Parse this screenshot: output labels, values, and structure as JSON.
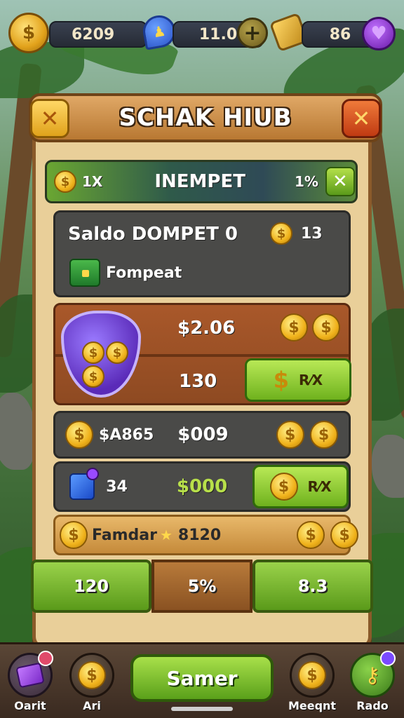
{
  "topbar": {
    "coins": "6209",
    "energy": "11.0",
    "gems": "86",
    "coin_icon_glyph": "$",
    "plus_glyph": "+"
  },
  "panel": {
    "title": "SCHAK HIUB",
    "close_glyph": "✕"
  },
  "wallet_bar": {
    "left_value": "1X",
    "label": "INEMPET",
    "right_value": "1%",
    "action_glyph": "✕"
  },
  "saldo": {
    "title": "Saldo DOMPET 0",
    "coin_value": "13",
    "item_label": "Fompeat"
  },
  "offer": {
    "price_top": "$2.06",
    "amount": "130",
    "buy_label": "R⁄X"
  },
  "rows": [
    {
      "left_label": "$A865",
      "value": "$009"
    },
    {
      "left_label": "34",
      "value": "$000",
      "buy_label": "R⁄X"
    },
    {
      "left_label": "Famdar",
      "star": "★",
      "value": "8120"
    }
  ],
  "bottom_tabs": {
    "left": "120",
    "middle": "5%",
    "right": "8.3"
  },
  "nav": {
    "items": [
      {
        "label": "Oarit"
      },
      {
        "label": "Ari"
      },
      {
        "label": "Meeqnt"
      },
      {
        "label": "Rado"
      }
    ],
    "main_button": "Samer"
  },
  "colors": {
    "panel_bg": "#e9cf99",
    "accent_green": "#6fb21e",
    "coin_gold": "#f0b21b"
  }
}
